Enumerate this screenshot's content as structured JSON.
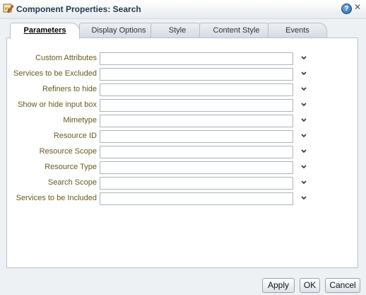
{
  "window": {
    "title": "Component Properties: Search",
    "help_label": "?",
    "close_label": "✕"
  },
  "tabs": [
    {
      "label": "Parameters",
      "active": true
    },
    {
      "label": "Display Options",
      "active": false
    },
    {
      "label": "Style",
      "active": false
    },
    {
      "label": "Content Style",
      "active": false
    },
    {
      "label": "Events",
      "active": false
    }
  ],
  "parameters": [
    {
      "label": "Custom Attributes",
      "value": ""
    },
    {
      "label": "Services to be Excluded",
      "value": ""
    },
    {
      "label": "Refiners to hide",
      "value": ""
    },
    {
      "label": "Show or hide input box",
      "value": ""
    },
    {
      "label": "Mimetype",
      "value": ""
    },
    {
      "label": "Resource ID",
      "value": ""
    },
    {
      "label": "Resource Scope",
      "value": ""
    },
    {
      "label": "Resource Type",
      "value": ""
    },
    {
      "label": "Search Scope",
      "value": ""
    },
    {
      "label": "Services to be Included",
      "value": ""
    }
  ],
  "buttons": {
    "apply": "Apply",
    "ok": "OK",
    "cancel": "Cancel"
  }
}
